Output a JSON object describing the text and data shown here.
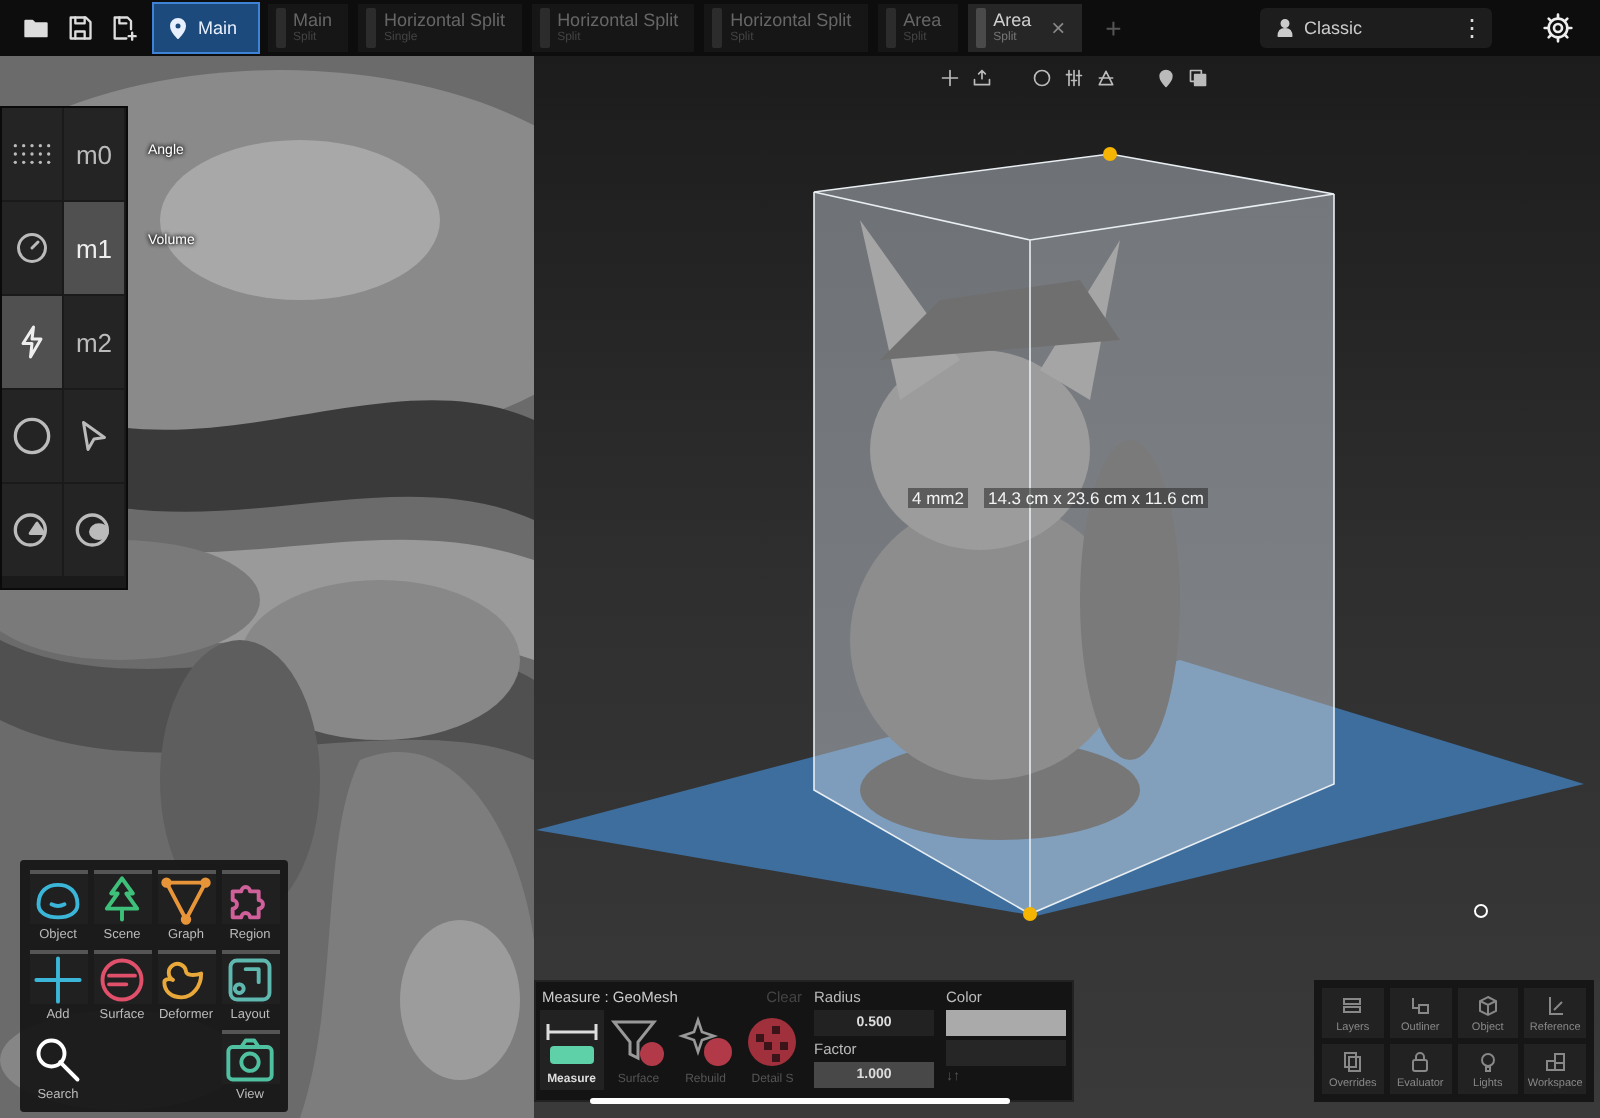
{
  "tabs": [
    {
      "title": "Main",
      "kind": "location",
      "selected": true,
      "focused": false
    },
    {
      "title": "Main",
      "subtitle": "Split",
      "kind": "plain",
      "selected": false,
      "focused": false
    },
    {
      "title": "Horizontal Split",
      "subtitle": "Single",
      "kind": "plain",
      "selected": false,
      "focused": false
    },
    {
      "title": "Horizontal Split",
      "subtitle": "Split",
      "kind": "plain",
      "selected": false,
      "focused": false
    },
    {
      "title": "Horizontal Split",
      "subtitle": "Split",
      "kind": "plain",
      "selected": false,
      "focused": false
    },
    {
      "title": "Area",
      "subtitle": "Split",
      "kind": "plain",
      "selected": false,
      "focused": false
    },
    {
      "title": "Area",
      "subtitle": "Split",
      "kind": "plain",
      "selected": false,
      "focused": true,
      "close": "×"
    }
  ],
  "new_tab": "+",
  "workspace": {
    "name": "Classic",
    "menu": "⋮"
  },
  "tool_panel": {
    "cells": [
      {
        "kind": "dots",
        "selected": false
      },
      {
        "kind": "text",
        "text": "m0",
        "selected": false
      },
      {
        "kind": "gauge",
        "selected": false
      },
      {
        "kind": "text",
        "text": "m1",
        "selected": true
      },
      {
        "kind": "bolt",
        "selected": true
      },
      {
        "kind": "text",
        "text": "m2",
        "selected": false
      },
      {
        "kind": "circle",
        "selected": false
      },
      {
        "kind": "pointer",
        "selected": false
      },
      {
        "kind": "tree-badge",
        "selected": false
      },
      {
        "kind": "blob-badge",
        "selected": false
      }
    ],
    "labels": [
      "Angle",
      "Volume"
    ]
  },
  "palette": [
    {
      "label": "Object",
      "kind": "object",
      "color": "#3bb5d8"
    },
    {
      "label": "Scene",
      "kind": "scene",
      "color": "#3ec07a"
    },
    {
      "label": "Graph",
      "kind": "graph",
      "color": "#e8953a"
    },
    {
      "label": "Region",
      "kind": "region",
      "color": "#d0609a"
    },
    {
      "label": "Add",
      "kind": "add",
      "color": "#3bb5d8"
    },
    {
      "label": "Surface",
      "kind": "surface",
      "color": "#e0506a"
    },
    {
      "label": "Deformer",
      "kind": "deformer",
      "color": "#e8a83a"
    },
    {
      "label": "Layout",
      "kind": "layout",
      "color": "#5fb8b0"
    },
    {
      "label": "Search",
      "kind": "search",
      "color": "#ffffff"
    },
    {
      "kind": "blank"
    },
    {
      "kind": "blank"
    },
    {
      "label": "View",
      "kind": "view",
      "color": "#4fc0a0"
    }
  ],
  "dimension": {
    "area": "4 mm2",
    "size": "14.3 cm x 23.6 cm x 11.6 cm"
  },
  "measure_panel": {
    "title": "Measure : GeoMesh",
    "clear": "Clear",
    "tools": [
      {
        "label": "Measure",
        "kind": "measure",
        "selected": true
      },
      {
        "label": "Surface",
        "kind": "surface",
        "selected": false
      },
      {
        "label": "Rebuild",
        "kind": "rebuild",
        "selected": false
      },
      {
        "label": "Detail S",
        "kind": "detail",
        "selected": false
      }
    ],
    "radius": {
      "label": "Radius",
      "value": "0.500"
    },
    "factor": {
      "label": "Factor",
      "value": "1.000"
    },
    "color": {
      "label": "Color",
      "swap": "↓↑"
    }
  },
  "views": [
    {
      "label": "Layers",
      "kind": "layers"
    },
    {
      "label": "Outliner",
      "kind": "outliner"
    },
    {
      "label": "Object",
      "kind": "object"
    },
    {
      "label": "Reference",
      "kind": "reference"
    },
    {
      "label": "Overrides",
      "kind": "overrides"
    },
    {
      "label": "Evaluator",
      "kind": "evaluator"
    },
    {
      "label": "Lights",
      "kind": "lights"
    },
    {
      "label": "Workspace",
      "kind": "workspace"
    }
  ]
}
